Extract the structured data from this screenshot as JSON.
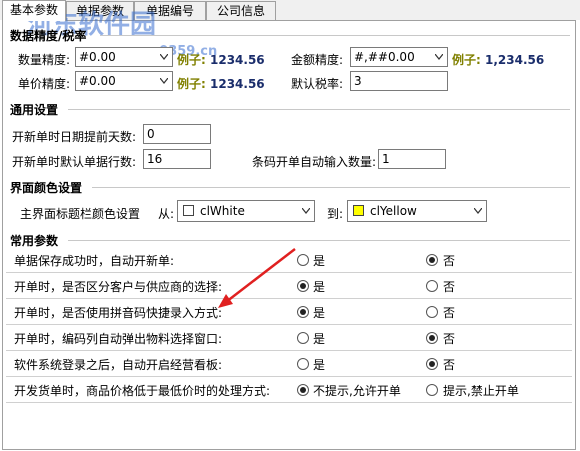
{
  "tabs": [
    "基本参数",
    "单据参数",
    "单据编号",
    "公司信息"
  ],
  "watermark": {
    "title": "河东软件园",
    "url": "www.pc0359.cn"
  },
  "precision": {
    "title": "数据精度/税率",
    "qty_label": "数量精度:",
    "qty_value": "#0.00",
    "amount_label": "金额精度:",
    "amount_value": "#,##0.00",
    "price_label": "单价精度:",
    "price_value": "#0.00",
    "tax_label": "默认税率:",
    "tax_value": "3",
    "example_label": "例子:",
    "qty_example": "1234.56",
    "amount_example": "1,234.56",
    "price_example": "1234.56"
  },
  "general": {
    "title": "通用设置",
    "advance_days_label": "开新单时日期提前天数:",
    "advance_days_value": "0",
    "default_rows_label": "开新单时默认单据行数:",
    "default_rows_value": "16",
    "barcode_qty_label": "条码开单自动输入数量:",
    "barcode_qty_value": "1"
  },
  "appearance": {
    "title": "界面颜色设置",
    "label": "主界面标题栏颜色设置",
    "from_label": "从:",
    "from_value": "clWhite",
    "from_color": "#ffffff",
    "to_label": "到:",
    "to_value": "clYellow",
    "to_color": "#ffff00"
  },
  "common": {
    "title": "常用参数",
    "yes": "是",
    "no": "否",
    "rows": [
      {
        "label": "单据保存成功时，自动开新单:",
        "selected": "no"
      },
      {
        "label": "开单时，是否区分客户与供应商的选择:",
        "selected": "yes"
      },
      {
        "label": "开单时，是否使用拼音码快捷录入方式:",
        "selected": "yes"
      },
      {
        "label": "开单时，编码列自动弹出物料选择窗口:",
        "selected": "no"
      },
      {
        "label": "软件系统登录之后，自动开启经营看板:",
        "selected": "no"
      }
    ],
    "last_row": {
      "label": "开发货单时，商品价格低于最低价时的处理方式:",
      "option_a": "不提示,允许开单",
      "option_b": "提示,禁止开单",
      "selected": "a"
    }
  },
  "colors": {
    "arrow": "#e02020",
    "example_key": "#808000",
    "example_value": "#1a2d6b"
  }
}
